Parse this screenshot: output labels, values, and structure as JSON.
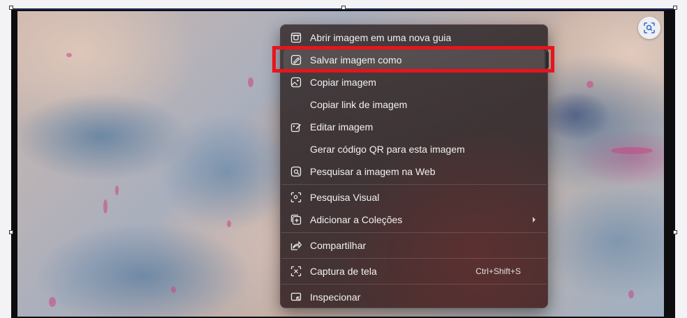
{
  "context_menu": {
    "items": [
      {
        "label": "Abrir imagem em uma nova guia",
        "icon": "open-in-new-tab-icon"
      },
      {
        "label": "Salvar imagem como",
        "icon": "save-image-icon"
      },
      {
        "label": "Copiar imagem",
        "icon": "copy-image-icon"
      },
      {
        "label": "Copiar link de imagem",
        "icon": ""
      },
      {
        "label": "Editar imagem",
        "icon": "edit-image-icon"
      },
      {
        "label": "Gerar código QR para esta imagem",
        "icon": ""
      },
      {
        "label": "Pesquisar a imagem na Web",
        "icon": "search-image-web-icon"
      },
      {
        "label": "Pesquisa Visual",
        "icon": "visual-search-icon"
      },
      {
        "label": "Adicionar a Coleções",
        "icon": "collections-icon",
        "submenu": true
      },
      {
        "label": "Compartilhar",
        "icon": "share-icon"
      },
      {
        "label": "Captura de tela",
        "icon": "screenshot-icon",
        "shortcut": "Ctrl+Shift+S"
      },
      {
        "label": "Inspecionar",
        "icon": "inspect-icon"
      }
    ],
    "highlighted_item": "Salvar imagem como"
  },
  "colors": {
    "highlight_border": "#e8141c",
    "menu_text": "#f2f2f2"
  }
}
